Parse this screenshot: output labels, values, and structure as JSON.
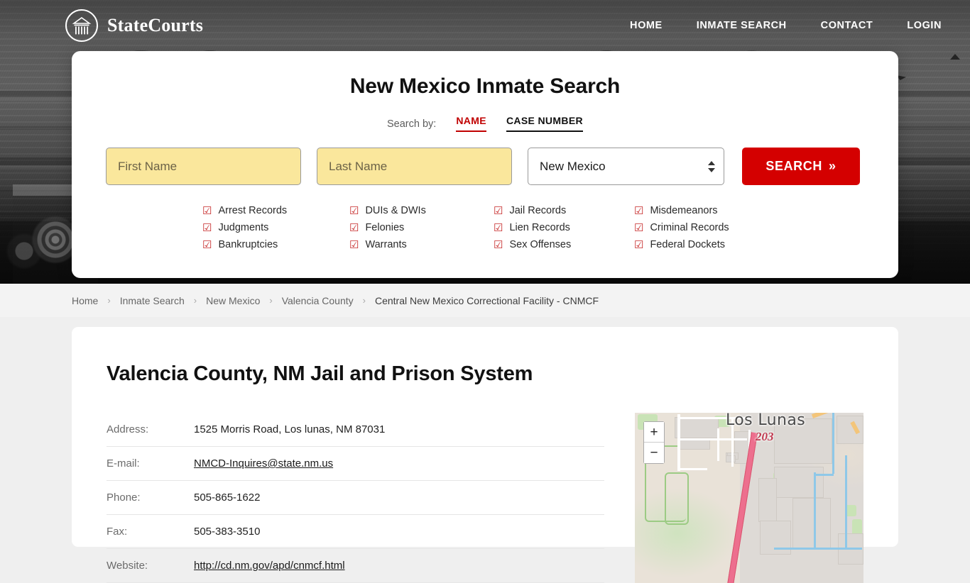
{
  "header": {
    "brand_name": "StateCourts",
    "logo_icon": "courthouse-circle-icon",
    "nav": [
      {
        "label": "HOME"
      },
      {
        "label": "INMATE SEARCH"
      },
      {
        "label": "CONTACT"
      },
      {
        "label": "LOGIN"
      }
    ]
  },
  "search_card": {
    "title": "New Mexico Inmate Search",
    "search_by_label": "Search by:",
    "tabs": [
      {
        "label": "NAME",
        "active": true
      },
      {
        "label": "CASE NUMBER",
        "active": false
      }
    ],
    "first_name_placeholder": "First Name",
    "first_name_value": "",
    "last_name_placeholder": "Last Name",
    "last_name_value": "",
    "state_value": "New Mexico",
    "search_button_label": "SEARCH",
    "search_button_chevron": "»",
    "check_glyph": "☑",
    "accent_red": "#d40000",
    "tab_red": "#c00000",
    "input_yellow": "#fae79c",
    "record_types": [
      "Arrest Records",
      "DUIs & DWIs",
      "Jail Records",
      "Misdemeanors",
      "Judgments",
      "Felonies",
      "Lien Records",
      "Criminal Records",
      "Bankruptcies",
      "Warrants",
      "Sex Offenses",
      "Federal Dockets"
    ]
  },
  "breadcrumb": {
    "separator": "›",
    "items": [
      {
        "label": "Home",
        "current": false
      },
      {
        "label": "Inmate Search",
        "current": false
      },
      {
        "label": "New Mexico",
        "current": false
      },
      {
        "label": "Valencia County",
        "current": false
      },
      {
        "label": "Central New Mexico Correctional Facility - CNMCF",
        "current": true
      }
    ]
  },
  "main": {
    "page_title": "Valencia County, NM Jail and Prison System",
    "info_rows": [
      {
        "key": "Address:",
        "value": "1525 Morris Road, Los lunas, NM 87031",
        "link": false
      },
      {
        "key": "E-mail:",
        "value": "NMCD-Inquires@state.nm.us",
        "link": true
      },
      {
        "key": "Phone:",
        "value": "505-865-1622",
        "link": false
      },
      {
        "key": "Fax:",
        "value": "505-383-3510",
        "link": false
      },
      {
        "key": "Website:",
        "value": "http://cd.nm.gov/apd/cnmcf.html",
        "link": true
      }
    ]
  },
  "map": {
    "city_label": "Los Lunas",
    "route_shield": "203",
    "zoom_in_label": "+",
    "zoom_out_label": "−"
  }
}
